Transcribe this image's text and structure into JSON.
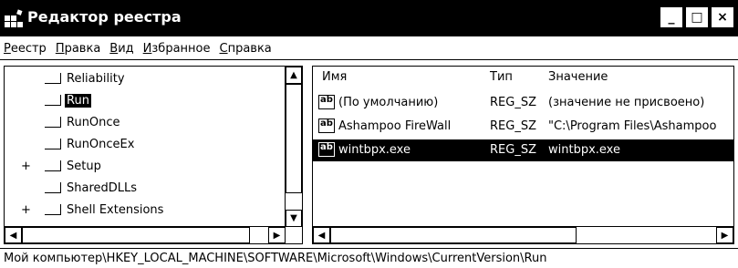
{
  "window": {
    "title": "Редактор реестра",
    "icon": "registry-editor-icon",
    "controls": {
      "minimize": "_",
      "maximize": "□",
      "close": "×"
    }
  },
  "menu": [
    {
      "label": "Реестр",
      "key": "Р"
    },
    {
      "label": "Правка",
      "key": "П"
    },
    {
      "label": "Вид",
      "key": "В"
    },
    {
      "label": "Избранное",
      "key": "И"
    },
    {
      "label": "Справка",
      "key": "С"
    }
  ],
  "tree": {
    "items": [
      {
        "label": "Reliability",
        "expander": "",
        "selected": false
      },
      {
        "label": "Run",
        "expander": "",
        "selected": true
      },
      {
        "label": "RunOnce",
        "expander": "",
        "selected": false
      },
      {
        "label": "RunOnceEx",
        "expander": "",
        "selected": false
      },
      {
        "label": "Setup",
        "expander": "+",
        "selected": false
      },
      {
        "label": "SharedDLLs",
        "expander": "",
        "selected": false
      },
      {
        "label": "Shell Extensions",
        "expander": "+",
        "selected": false
      }
    ]
  },
  "list": {
    "columns": {
      "name": "Имя",
      "type": "Тип",
      "value": "Значение"
    },
    "rows": [
      {
        "icon": "ab",
        "name": "(По умолчанию)",
        "type": "REG_SZ",
        "value": "(значение не присвоено)",
        "selected": false
      },
      {
        "icon": "ab",
        "name": "Ashampoo FireWall",
        "type": "REG_SZ",
        "value": "\"C:\\Program Files\\Ashampoo",
        "selected": false
      },
      {
        "icon": "ab",
        "name": "wintbpx.exe",
        "type": "REG_SZ",
        "value": "wintbpx.exe",
        "selected": true
      }
    ]
  },
  "status": {
    "path": "Мой компьютер\\HKEY_LOCAL_MACHINE\\SOFTWARE\\Microsoft\\Windows\\CurrentVersion\\Run"
  }
}
